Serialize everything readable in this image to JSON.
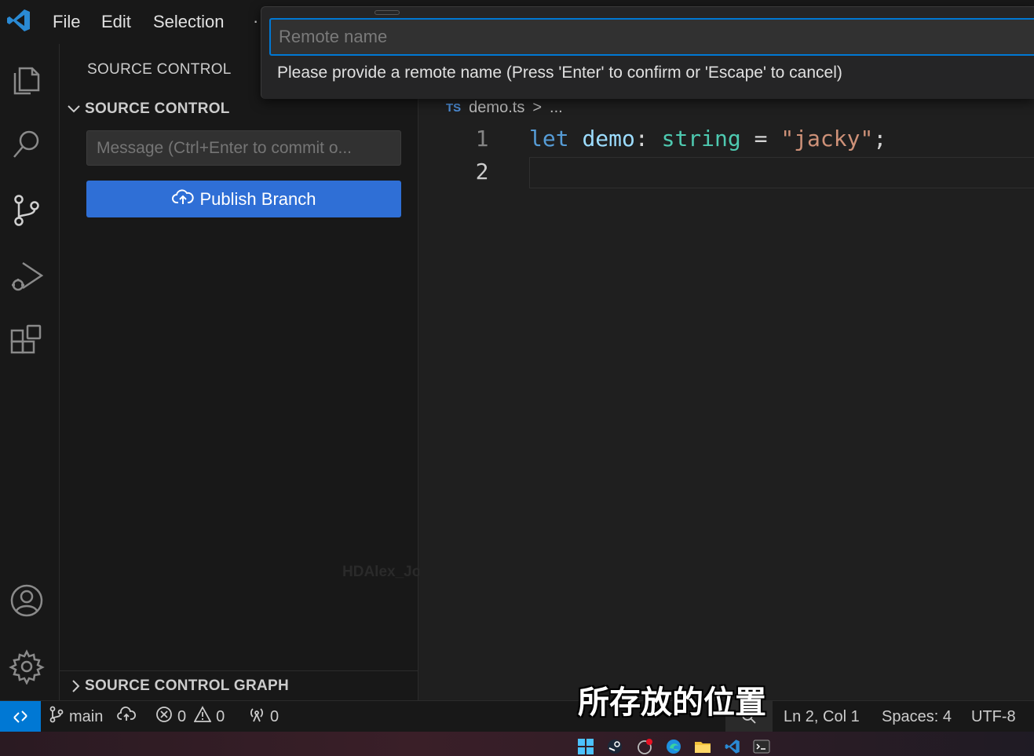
{
  "menu": {
    "file": "File",
    "edit": "Edit",
    "selection": "Selection",
    "more": "·"
  },
  "activity_bar": {
    "items": [
      "explorer-icon",
      "search-icon",
      "source-control-icon",
      "run-debug-icon",
      "extensions-icon"
    ],
    "bottom": [
      "accounts-icon",
      "manage-gear-icon"
    ]
  },
  "sidebar": {
    "title": "SOURCE CONTROL",
    "section_label": "SOURCE CONTROL",
    "commit_placeholder": "Message (Ctrl+Enter to commit o...",
    "publish_label": "Publish Branch",
    "watermark": "HDAlex_John",
    "graph_label": "SOURCE CONTROL GRAPH"
  },
  "quick_input": {
    "placeholder": "Remote name",
    "hint": "Please provide a remote name (Press 'Enter' to confirm or 'Escape' to cancel)"
  },
  "editor": {
    "breadcrumb_lang": "TS",
    "breadcrumb_file": "demo.ts",
    "breadcrumb_sep": ">",
    "breadcrumb_more": "...",
    "lines": [
      {
        "number": "1",
        "keyword": "let",
        "name": "demo",
        "colon": ":",
        "type": "string",
        "eq": "=",
        "value": "\"jacky\"",
        "semi": ";"
      },
      {
        "number": "2"
      }
    ]
  },
  "subtitle": "所存放的位置",
  "status": {
    "branch": "main",
    "errors": "0",
    "warnings": "0",
    "ports": "0",
    "position": "Ln 2, Col 1",
    "spaces": "Spaces: 4",
    "encoding": "UTF-8"
  },
  "colors": {
    "accent": "#0078d4",
    "publish_button": "#2f6fd6"
  }
}
